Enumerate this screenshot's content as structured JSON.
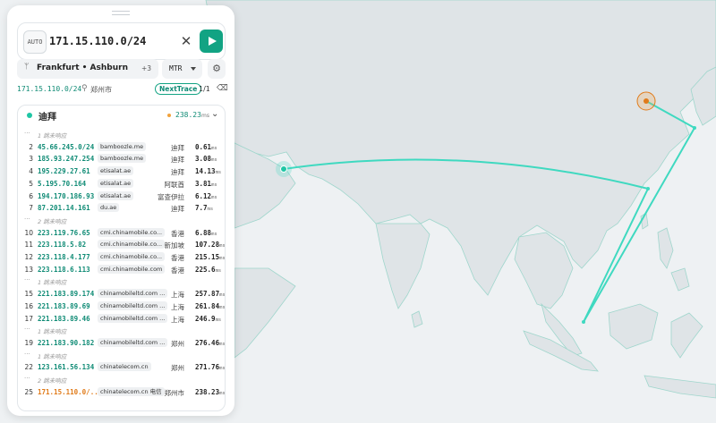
{
  "search": {
    "mode_label": "AUTO",
    "target": "171.15.110.0/24",
    "clear_icon": "close-icon",
    "run_icon": "play-icon"
  },
  "probe_selector": {
    "label": "Frankfurt • Ashburn",
    "more": "+3",
    "icon": "antenna-icon"
  },
  "protocol": {
    "value": "MTR"
  },
  "settings_icon": "gear-icon",
  "result_meta": {
    "target_prefix": "171.15.110.0/24",
    "location": "郑州市",
    "tool_badge": "NextTrace",
    "page": "1/1"
  },
  "probe_card": {
    "city": "迪拜",
    "avg_latency": "238.23",
    "unit": "ms"
  },
  "hops": [
    {
      "kind": "gap",
      "note": "1 跳未响应"
    },
    {
      "kind": "hop",
      "n": "2",
      "ip": "45.66.245.0/24",
      "host": "bamboozle.me",
      "geo": "迪拜",
      "lat": "0.61"
    },
    {
      "kind": "hop",
      "n": "3",
      "ip": "185.93.247.254",
      "host": "bamboozle.me",
      "geo": "迪拜",
      "lat": "3.08"
    },
    {
      "kind": "hop",
      "n": "4",
      "ip": "195.229.27.61",
      "host": "etisalat.ae",
      "geo": "迪拜",
      "lat": "14.13"
    },
    {
      "kind": "hop",
      "n": "5",
      "ip": "5.195.70.164",
      "host": "etisalat.ae",
      "geo": "阿联酋",
      "lat": "3.81"
    },
    {
      "kind": "hop",
      "n": "6",
      "ip": "194.170.186.93",
      "host": "etisalat.ae",
      "geo": "富查伊拉",
      "lat": "6.12"
    },
    {
      "kind": "hop",
      "n": "7",
      "ip": "87.201.14.161",
      "host": "du.ae",
      "geo": "迪拜",
      "lat": "7.7"
    },
    {
      "kind": "gap",
      "note": "2 跳未响应"
    },
    {
      "kind": "hop",
      "n": "10",
      "ip": "223.119.76.65",
      "host": "cmi.chinamobile.co...",
      "geo": "香港",
      "lat": "6.88"
    },
    {
      "kind": "hop",
      "n": "11",
      "ip": "223.118.5.82",
      "host": "cmi.chinamobile.co...",
      "geo": "新加坡",
      "lat": "107.28"
    },
    {
      "kind": "hop",
      "n": "12",
      "ip": "223.118.4.177",
      "host": "cmi.chinamobile.co...",
      "geo": "香港",
      "lat": "215.15"
    },
    {
      "kind": "hop",
      "n": "13",
      "ip": "223.118.6.113",
      "host": "cmi.chinamobile.com",
      "geo": "香港",
      "lat": "225.6"
    },
    {
      "kind": "gap",
      "note": "1 跳未响应"
    },
    {
      "kind": "hop",
      "n": "15",
      "ip": "221.183.89.174",
      "host": "chinamobileltd.com ...",
      "geo": "上海",
      "lat": "257.87"
    },
    {
      "kind": "hop",
      "n": "16",
      "ip": "221.183.89.69",
      "host": "chinamobileltd.com ...",
      "geo": "上海",
      "lat": "261.84"
    },
    {
      "kind": "hop",
      "n": "17",
      "ip": "221.183.89.46",
      "host": "chinamobileltd.com ...",
      "geo": "上海",
      "lat": "246.9"
    },
    {
      "kind": "gap",
      "note": "1 跳未响应"
    },
    {
      "kind": "hop",
      "n": "19",
      "ip": "221.183.90.182",
      "host": "chinamobileltd.com ...",
      "geo": "郑州",
      "lat": "276.46"
    },
    {
      "kind": "gap",
      "note": "1 跳未响应"
    },
    {
      "kind": "hop",
      "n": "22",
      "ip": "123.161.56.134",
      "host": "chinatelecom.cn",
      "geo": "郑州",
      "lat": "271.76"
    },
    {
      "kind": "gap",
      "note": "2 跳未响应"
    },
    {
      "kind": "hop",
      "n": "25",
      "ip": "171.15.110.0/...",
      "host": "chinatelecom.cn 电信",
      "geo": "郑州市",
      "lat": "238.23",
      "dest": true
    }
  ],
  "latency_unit": "ms",
  "colors": {
    "accent": "#12a383",
    "route": "#3fd9c0",
    "destination": "#e07b1a",
    "land": "#dfe4e7",
    "sea": "#eef1f3"
  }
}
